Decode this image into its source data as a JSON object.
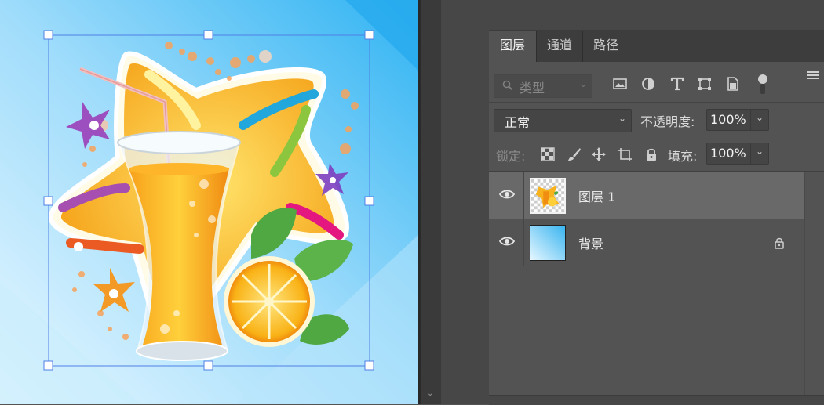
{
  "colors": {
    "app_bg": "#535353",
    "selected_layer": "#696969",
    "transform_box": "#4f7fe6",
    "sky_light": "#aee4fb",
    "sky_dark": "#3ab6f2"
  },
  "panel": {
    "tabs": [
      {
        "label": "图层",
        "active": true
      },
      {
        "label": "通道",
        "active": false
      },
      {
        "label": "路径",
        "active": false
      }
    ],
    "menu_icon": "hamburger-icon"
  },
  "filter": {
    "kind_label": "类型",
    "icons": [
      "image-filter-icon",
      "adjustment-filter-icon",
      "type-filter-icon",
      "shape-filter-icon",
      "smart-object-filter-icon",
      "filter-toggle-icon"
    ]
  },
  "blend": {
    "mode": "正常",
    "opacity_label": "不透明度:",
    "opacity_value": "100%"
  },
  "lock": {
    "label": "锁定:",
    "icons": [
      "lock-transparent-icon",
      "lock-paint-icon",
      "lock-move-icon",
      "lock-artboard-icon",
      "lock-all-icon"
    ],
    "fill_label": "填充:",
    "fill_value": "100%"
  },
  "layers": [
    {
      "name": "图层 1",
      "visible": true,
      "selected": true,
      "locked": false
    },
    {
      "name": "背景",
      "visible": true,
      "selected": false,
      "locked": true
    }
  ]
}
